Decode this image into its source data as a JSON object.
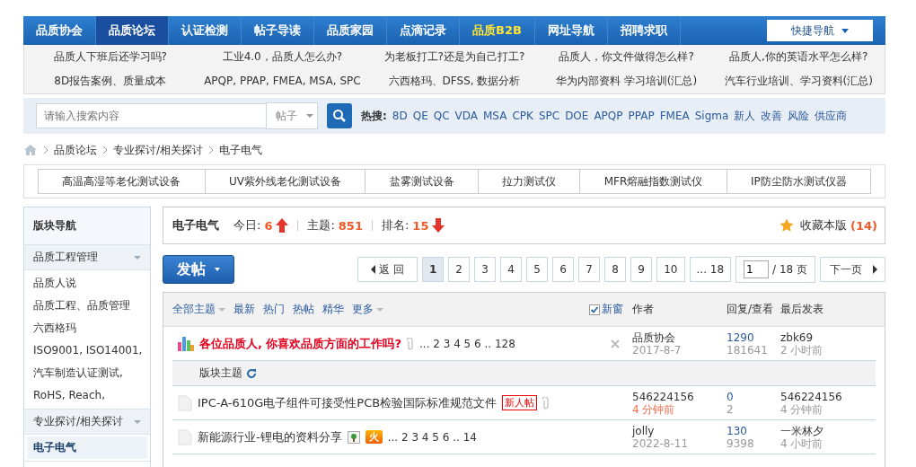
{
  "nav": {
    "tabs": [
      {
        "label": "品质协会",
        "selected": false,
        "kind": "plain"
      },
      {
        "label": "品质论坛",
        "selected": true,
        "kind": "plain"
      },
      {
        "label": "认证检测",
        "selected": false,
        "kind": "plain"
      },
      {
        "label": "帖子导读",
        "selected": false,
        "kind": "plain"
      },
      {
        "label": "品质家园",
        "selected": false,
        "kind": "plain"
      },
      {
        "label": "点滴记录",
        "selected": false,
        "kind": "plain"
      },
      {
        "label": "品质B2B",
        "selected": false,
        "kind": "highlight"
      },
      {
        "label": "网址导航",
        "selected": false,
        "kind": "plain"
      },
      {
        "label": "招聘求职",
        "selected": false,
        "kind": "plain"
      }
    ],
    "quick_nav": "快捷导航"
  },
  "featured_links": [
    [
      "品质人下班后还学习吗?",
      "工业4.0，品质人怎么办?",
      "为老板打工?还是为自己打工?",
      "品质人，你文件做得怎么样?",
      "品质人,你的英语水平怎么样?"
    ],
    [
      "8D报告案例、质量成本",
      "APQP, PPAP, FMEA, MSA, SPC",
      "六西格玛、DFSS, 数据分析",
      "华为内部资料 学习培训(汇总)",
      "汽车行业培训、学习资料(汇总)"
    ]
  ],
  "search": {
    "placeholder": "请输入搜索内容",
    "scope": "帖子",
    "hot_label": "热搜:",
    "hot": [
      "8D",
      "QE",
      "QC",
      "VDA",
      "MSA",
      "CPK",
      "SPC",
      "DOE",
      "APQP",
      "PPAP",
      "FMEA",
      "Sigma",
      "新人",
      "改善",
      "风险",
      "供应商"
    ]
  },
  "breadcrumb": [
    "品质论坛",
    "专业探讨/相关探讨",
    "电子电气"
  ],
  "categories": [
    "高温高湿等老化测试设备",
    "UV紫外线老化测试设备",
    "盐雾测试设备",
    "拉力测试仪",
    "MFR熔融指数测试仪",
    "IP防尘防水测试仪器"
  ],
  "sidebar": {
    "title": "版块导航",
    "groups": [
      {
        "label": "品质工程管理",
        "expanded": true,
        "children": [
          {
            "label": "品质人说",
            "selected": false
          },
          {
            "label": "品质工程、品质管理",
            "selected": false
          },
          {
            "label": "六西格玛",
            "selected": false
          },
          {
            "label": "ISO9001, ISO14001,",
            "selected": false
          },
          {
            "label": "汽车制造认证测试,",
            "selected": false
          },
          {
            "label": "RoHS, Reach,",
            "selected": false
          }
        ]
      },
      {
        "label": "专业探讨/相关探讨",
        "expanded": true,
        "children": [
          {
            "label": "电子电气",
            "selected": true
          }
        ]
      }
    ]
  },
  "forum": {
    "name": "电子电气",
    "stats": [
      {
        "label": "今日:",
        "value": "6",
        "kind": "up"
      },
      {
        "label": "主题:",
        "value": "851",
        "kind": "plain"
      },
      {
        "label": "排名:",
        "value": "15",
        "kind": "down"
      }
    ],
    "favorite": "收藏本版",
    "favorite_count": "(14)"
  },
  "post_button": "发帖",
  "pager": {
    "back": "返 回",
    "pages": [
      {
        "label": "1",
        "selected": true
      },
      {
        "label": "2",
        "selected": false
      },
      {
        "label": "3",
        "selected": false
      },
      {
        "label": "4",
        "selected": false
      },
      {
        "label": "5",
        "selected": false
      },
      {
        "label": "6",
        "selected": false
      },
      {
        "label": "7",
        "selected": false
      },
      {
        "label": "8",
        "selected": false
      },
      {
        "label": "9",
        "selected": false
      },
      {
        "label": "10",
        "selected": false
      },
      {
        "label": "... 18",
        "selected": false
      }
    ],
    "page_input": "1",
    "total": "/ 18 页",
    "next": "下一页"
  },
  "filters": [
    {
      "label": "全部主题",
      "dropdown": true
    },
    {
      "label": "最新",
      "dropdown": false
    },
    {
      "label": "热门",
      "dropdown": false
    },
    {
      "label": "热帖",
      "dropdown": false
    },
    {
      "label": "精华",
      "dropdown": false
    },
    {
      "label": "更多",
      "dropdown": true
    }
  ],
  "new_window": {
    "label": "新窗",
    "checked": true
  },
  "columns": [
    "作者",
    "回复/查看",
    "最后发表"
  ],
  "threads": [
    {
      "kind": "sticky",
      "title": "各位品质人, 你喜欢品质方面的工作吗?",
      "attachment": true,
      "pages": "... 2 3 4 5 6 .. 128",
      "author": "品质协会",
      "date": "2017-8-7",
      "recent": false,
      "replies": "1290",
      "views": "181641",
      "last_user": "zbk69",
      "last_time": "2 小时前"
    },
    {
      "kind": "separator",
      "title": "版块主题"
    },
    {
      "kind": "normal",
      "title": "IPC-A-610G电子组件可接受性PCB检验国际标准规范文件",
      "tag": "新人帖",
      "attachment": true,
      "author": "546224156",
      "date": "4 分钟前",
      "recent": true,
      "replies": "0",
      "views": "2",
      "last_user": "546224156",
      "last_time": "4 分钟前"
    },
    {
      "kind": "normal",
      "title": "新能源行业-锂电的资料分享",
      "image": true,
      "hot": "火",
      "attachment": false,
      "pages": "... 2 3 4 5 6 .. 14",
      "author": "jolly",
      "date": "2022-8-11",
      "recent": false,
      "replies": "130",
      "views": "9398",
      "last_user": "一米林夕",
      "last_time": "4 小时前"
    }
  ]
}
